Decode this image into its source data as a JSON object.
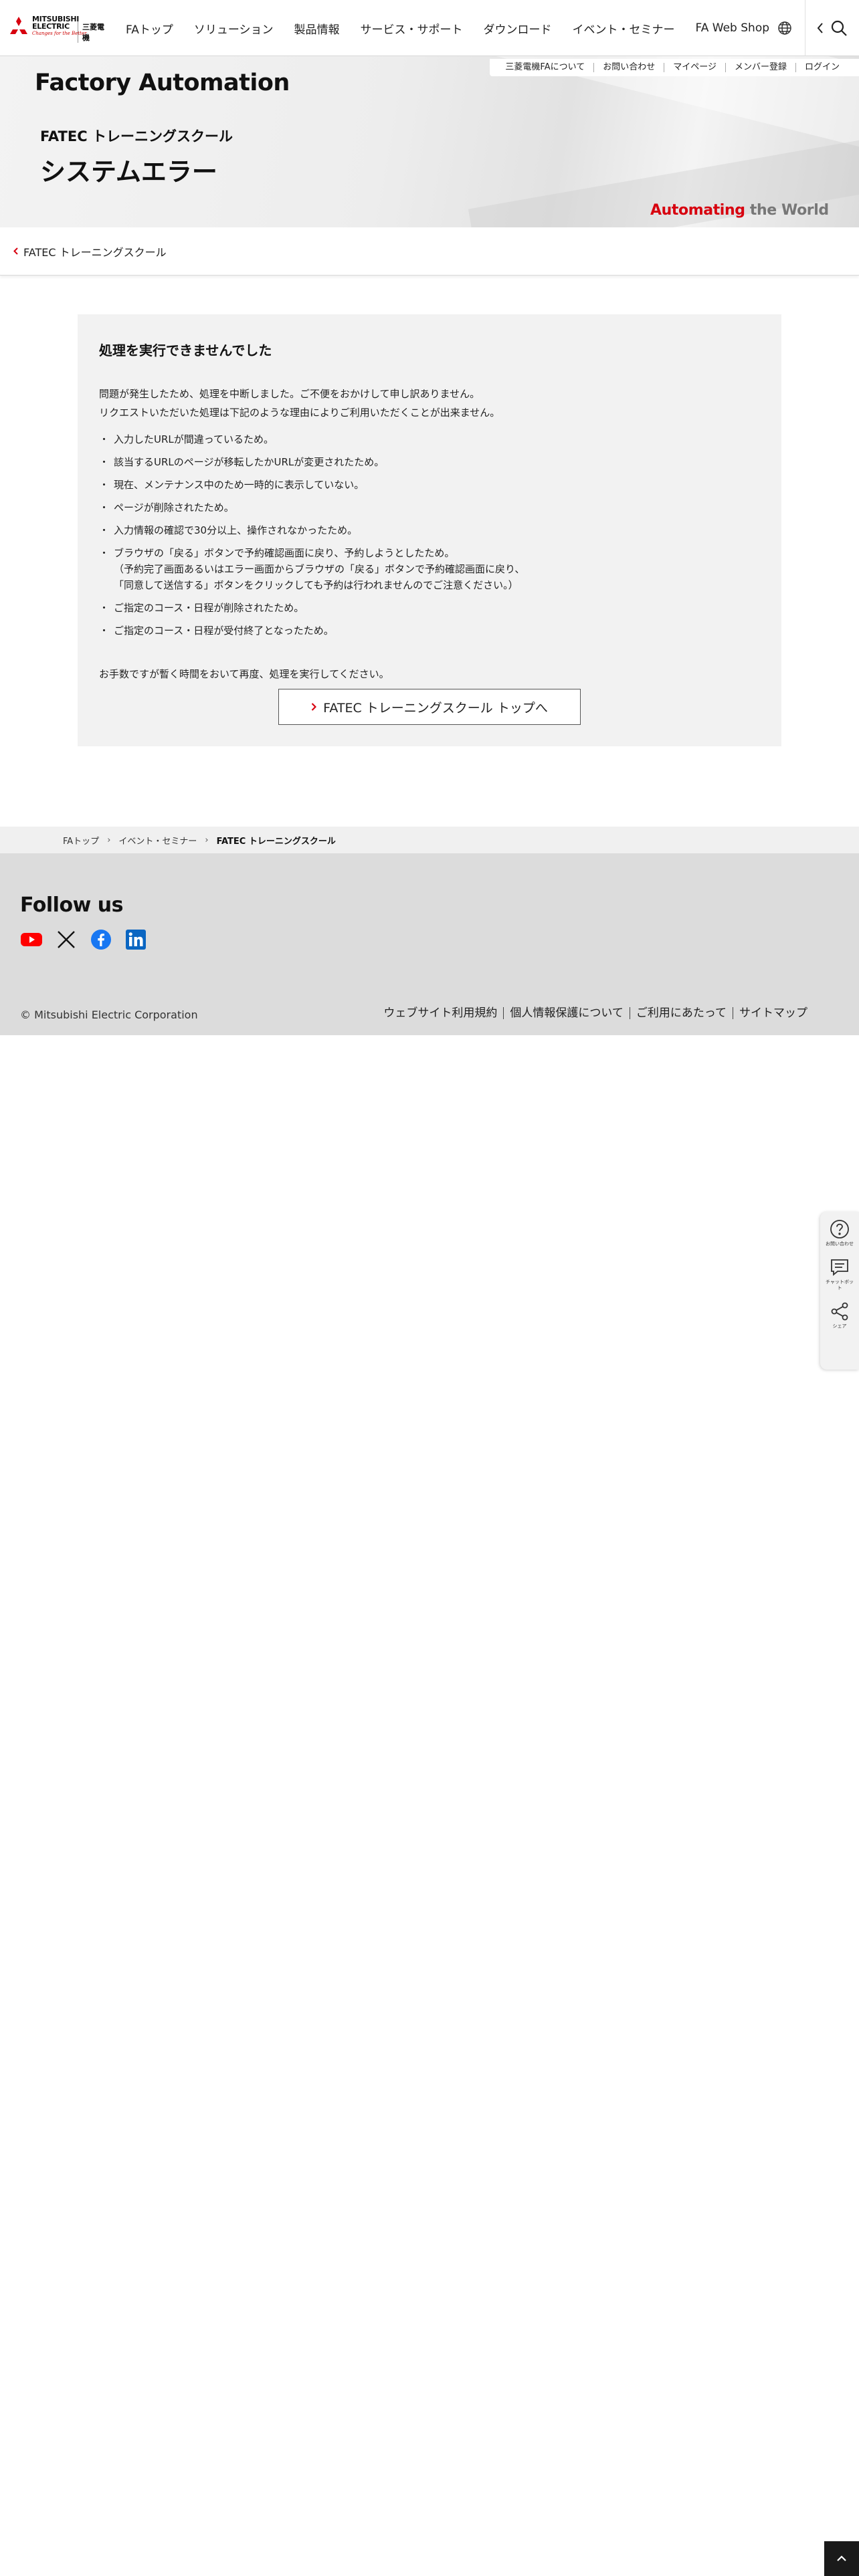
{
  "header": {
    "logo_en_line1": "MITSUBISHI",
    "logo_en_line2": "ELECTRIC",
    "logo_tagline": "Changes for the Better",
    "logo_jp": "三菱電機",
    "nav": [
      "FAトップ",
      "ソリューション",
      "製品情報",
      "サービス・サポート",
      "ダウンロード",
      "イベント・セミナー",
      "FA Web Shop"
    ],
    "icons": [
      "globe-icon",
      "chevron-left-icon",
      "search-icon"
    ]
  },
  "hero": {
    "util_links": [
      "三菱電機FAについて",
      "お問い合わせ",
      "マイページ",
      "メンバー登録",
      "ログイン"
    ],
    "brand_title": "Factory Automation",
    "subtitle": "FATEC トレーニングスクール",
    "title": "システムエラー",
    "slogan_red": "Automating",
    "slogan_gray": " the World"
  },
  "subnav": {
    "back_link": "FATEC トレーニングスクール"
  },
  "error": {
    "heading": "処理を実行できませんでした",
    "intro_line1": "問題が発生したため、処理を中断しました。ご不便をおかけして申し訳ありません。",
    "intro_line2": "リクエストいただいた処理は下記のような理由によりご利用いただくことが出来ません。",
    "reasons": [
      "入力したURLが間違っているため。",
      "該当するURLのページが移転したかURLが変更されたため。",
      "現在、メンテナンス中のため一時的に表示していない。",
      "ページが削除されたため。",
      "入力情報の確認で30分以上、操作されなかったため。"
    ],
    "reason_browser_line1": "ブラウザの「戻る」ボタンで予約確認画面に戻り、予約しようとしたため。",
    "reason_browser_line2": "（予約完了画面あるいはエラー画面からブラウザの「戻る」ボタンで予約確認画面に戻り、",
    "reason_browser_line3": "「同意して送信する」ボタンをクリックしても予約は行われませんのでご注意ください。）",
    "reasons_after": [
      "ご指定のコース・日程が削除されたため。",
      "ご指定のコース・日程が受付終了となったため。"
    ],
    "footer_text": "お手数ですが暫く時間をおいて再度、処理を実行してください。",
    "button_label": "FATEC トレーニングスクール トップへ"
  },
  "breadcrumb": {
    "items": [
      "FAトップ",
      "イベント・セミナー"
    ],
    "current": "FATEC トレーニングスクール"
  },
  "footer": {
    "follow_heading": "Follow us",
    "social": [
      "youtube-icon",
      "x-icon",
      "facebook-icon",
      "linkedin-icon"
    ],
    "copyright": "© Mitsubishi Electric Corporation",
    "links": [
      "ウェブサイト利用規約",
      "個人情報保護について",
      "ご利用にあたって",
      "サイトマップ"
    ]
  },
  "side_widget": {
    "inquiry_label": "お問い合わせ",
    "chatbot_label": "チャットボット",
    "share_label": "シェア"
  },
  "colors": {
    "brand_red": "#d7000f",
    "facebook_blue": "#1877f2",
    "linkedin_blue": "#0a66c2",
    "youtube_red": "#ff0000"
  }
}
